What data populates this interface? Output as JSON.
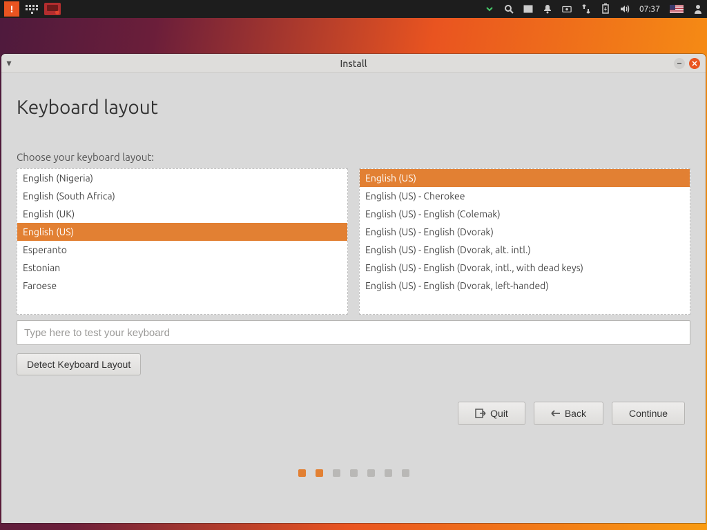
{
  "panel": {
    "time": "07:37"
  },
  "window": {
    "title": "Install"
  },
  "page": {
    "heading": "Keyboard layout",
    "instruction": "Choose your keyboard layout:",
    "test_placeholder": "Type here to test your keyboard",
    "detect_button": "Detect Keyboard Layout",
    "quit_button": "Quit",
    "back_button": "Back",
    "continue_button": "Continue"
  },
  "layouts": {
    "selected_index": 3,
    "items": [
      "English (Nigeria)",
      "English (South Africa)",
      "English (UK)",
      "English (US)",
      "Esperanto",
      "Estonian",
      "Faroese"
    ]
  },
  "variants": {
    "selected_index": 0,
    "items": [
      "English (US)",
      "English (US) - Cherokee",
      "English (US) - English (Colemak)",
      "English (US) - English (Dvorak)",
      "English (US) - English (Dvorak, alt. intl.)",
      "English (US) - English (Dvorak, intl., with dead keys)",
      "English (US) - English (Dvorak, left-handed)"
    ]
  },
  "progress": {
    "total": 7,
    "completed": 2
  }
}
